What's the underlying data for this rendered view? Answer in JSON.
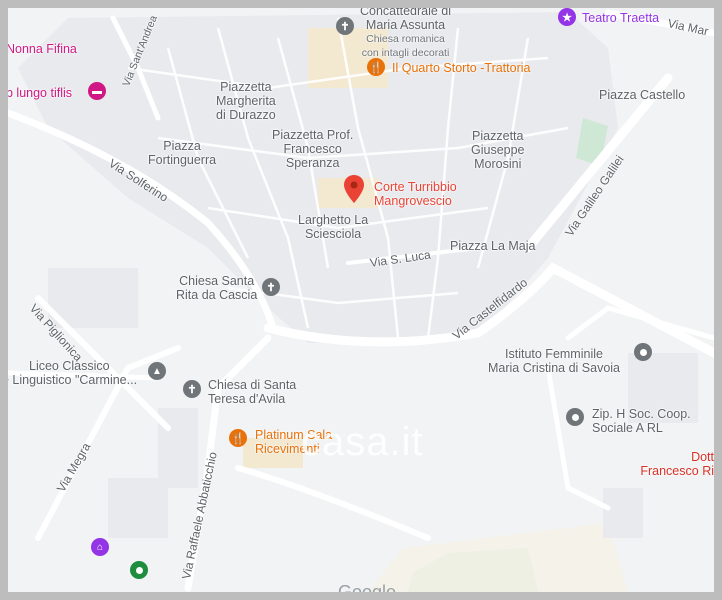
{
  "places": {
    "concattedrale": {
      "line1": "Concattedrale di",
      "line2": "Maria Assunta",
      "sub1": "Chiesa romanica",
      "sub2": "con intagli decorati"
    },
    "teatro": "Teatro Traetta",
    "nonna": "Nonna Fifina",
    "bnb": "b lungo tiflis",
    "quarto": "Il Quarto Storto -Trattoria",
    "corte": {
      "line1": "Corte Turribbio",
      "line2": "Mangrovescio"
    },
    "chiesa_rita": {
      "line1": "Chiesa Santa",
      "line2": "Rita da Cascia"
    },
    "liceo": {
      "line1": "Liceo Classico",
      "line2": "e Linguistico \"Carmine..."
    },
    "chiesa_teresa": {
      "line1": "Chiesa di Santa",
      "line2": "Teresa d'Avila"
    },
    "platinum": {
      "line1": "Platinum Sala",
      "line2": "Ricevimenti"
    },
    "istituto": {
      "line1": "Istituto Femminile",
      "line2": "Maria Cristina di Savoia"
    },
    "zip": {
      "line1": "Zip. H Soc. Coop.",
      "line2": "Sociale A RL"
    },
    "dott": {
      "line1": "Dott",
      "line2": "Francesco Ri"
    }
  },
  "squares": {
    "durazzo": [
      "Piazzetta",
      "Margherita",
      "di Durazzo"
    ],
    "fortinguerra": [
      "Piazza",
      "Fortinguerra"
    ],
    "speranza": [
      "Piazzetta Prof.",
      "Francesco",
      "Speranza"
    ],
    "morosini": [
      "Piazzetta",
      "Giuseppe",
      "Morosini"
    ],
    "castello": [
      "Piazza Castello"
    ],
    "larghetto": [
      "Larghetto La",
      "Sciesciola"
    ],
    "maja": [
      "Piazza La Maja"
    ]
  },
  "streets": {
    "via_mar": "Via Mar",
    "via_sant_andrea": "Via Sant'Andrea",
    "via_solferino": "Via Solferino",
    "via_galilei": "Via Galileo Galilei",
    "via_s_luca": "Via S. Luca",
    "via_castelfidardo": "Via Castelfidardo",
    "via_piglionica": "Via Piglionica",
    "via_megra": "Via Megra",
    "via_abbaticchio": "Via Raffaele Abbaticchio"
  },
  "watermark": "casa.it",
  "provider": "Google",
  "colors": {
    "background": "#f1f3f4",
    "buildings": "#e8eaed",
    "roads": "#ffffff",
    "food": "#e8710a",
    "pin": "#ea4335",
    "purple": "#9334e6",
    "green_space": "#cfe8d6",
    "attraction": "#1e8e3e"
  },
  "icons": [
    "map-pin-icon",
    "restaurant-icon",
    "church-icon",
    "school-icon",
    "hotel-icon",
    "theater-icon",
    "generic-poi-icon"
  ]
}
